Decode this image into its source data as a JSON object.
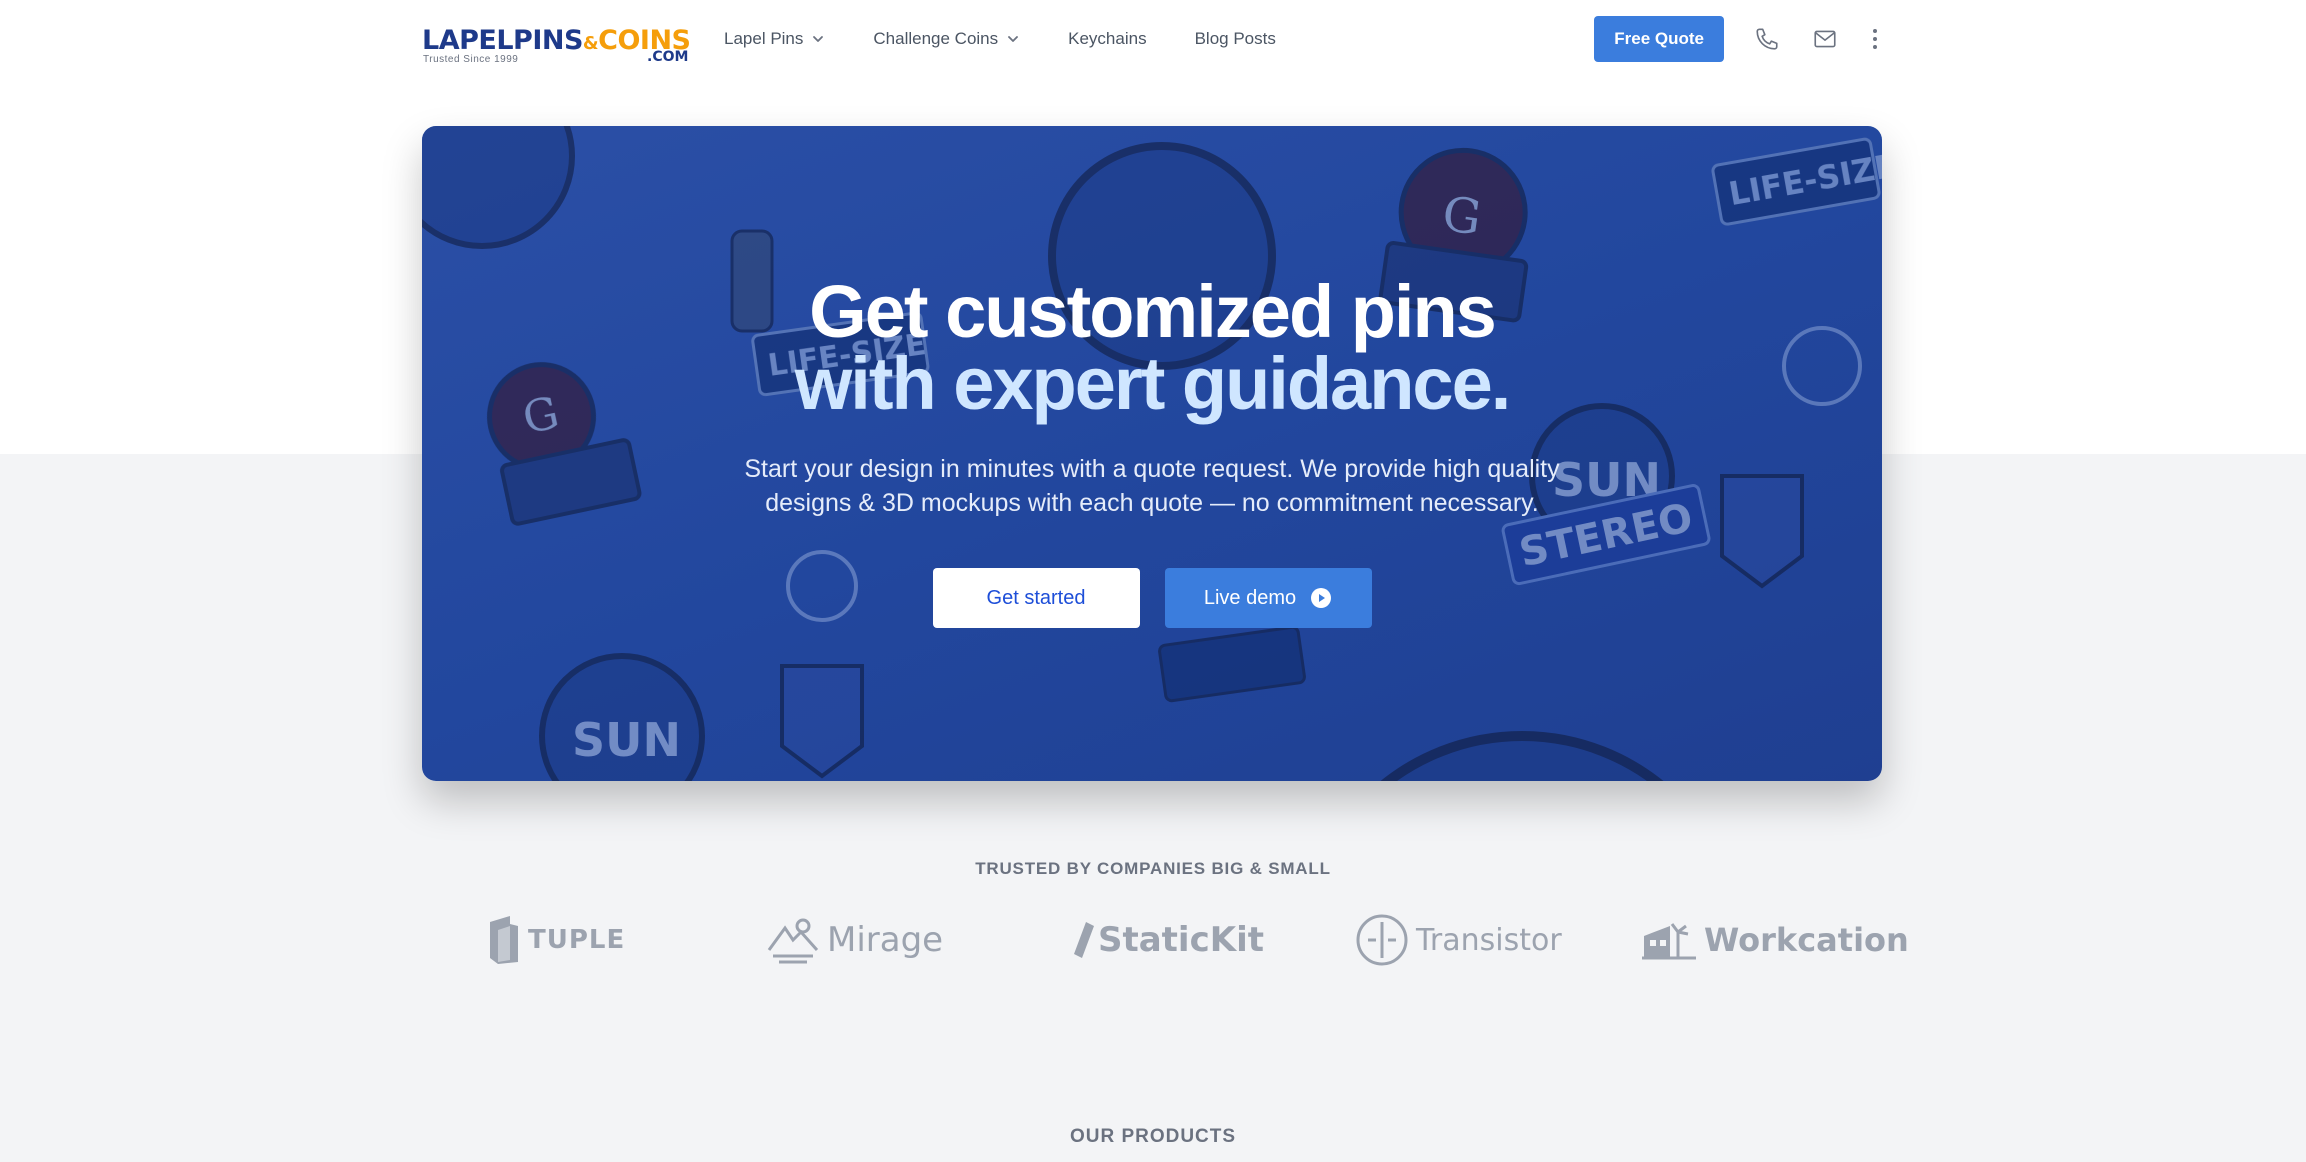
{
  "header": {
    "logo": {
      "part1": "LAPELPINS",
      "amp": "&",
      "part2": "COINS",
      "dotcom": ".COM",
      "tagline": "Trusted Since 1999"
    },
    "nav": [
      {
        "label": "Lapel Pins",
        "dropdown": true
      },
      {
        "label": "Challenge Coins",
        "dropdown": true
      },
      {
        "label": "Keychains",
        "dropdown": false
      },
      {
        "label": "Blog Posts",
        "dropdown": false
      }
    ],
    "quote_label": "Free Quote",
    "icons": [
      "phone-icon",
      "mail-icon",
      "more-vertical-icon"
    ]
  },
  "hero": {
    "title_line1": "Get customized pins",
    "title_line2": "with expert guidance.",
    "subtitle": "Start your design in minutes with a quote request. We provide high quality designs & 3D mockups with each quote — no commitment necessary.",
    "primary_label": "Get started",
    "secondary_label": "Live demo"
  },
  "trusted": {
    "heading": "TRUSTED BY COMPANIES BIG & SMALL",
    "brands": [
      "TUPLE",
      "Mirage",
      "StaticKit",
      "Transistor",
      "Workcation"
    ]
  },
  "products": {
    "heading": "OUR PRODUCTS"
  },
  "colors": {
    "accent": "#3b7ddd",
    "hero_bg": "#22479e",
    "navy": "#1e3a8a",
    "orange": "#f59e0b"
  }
}
